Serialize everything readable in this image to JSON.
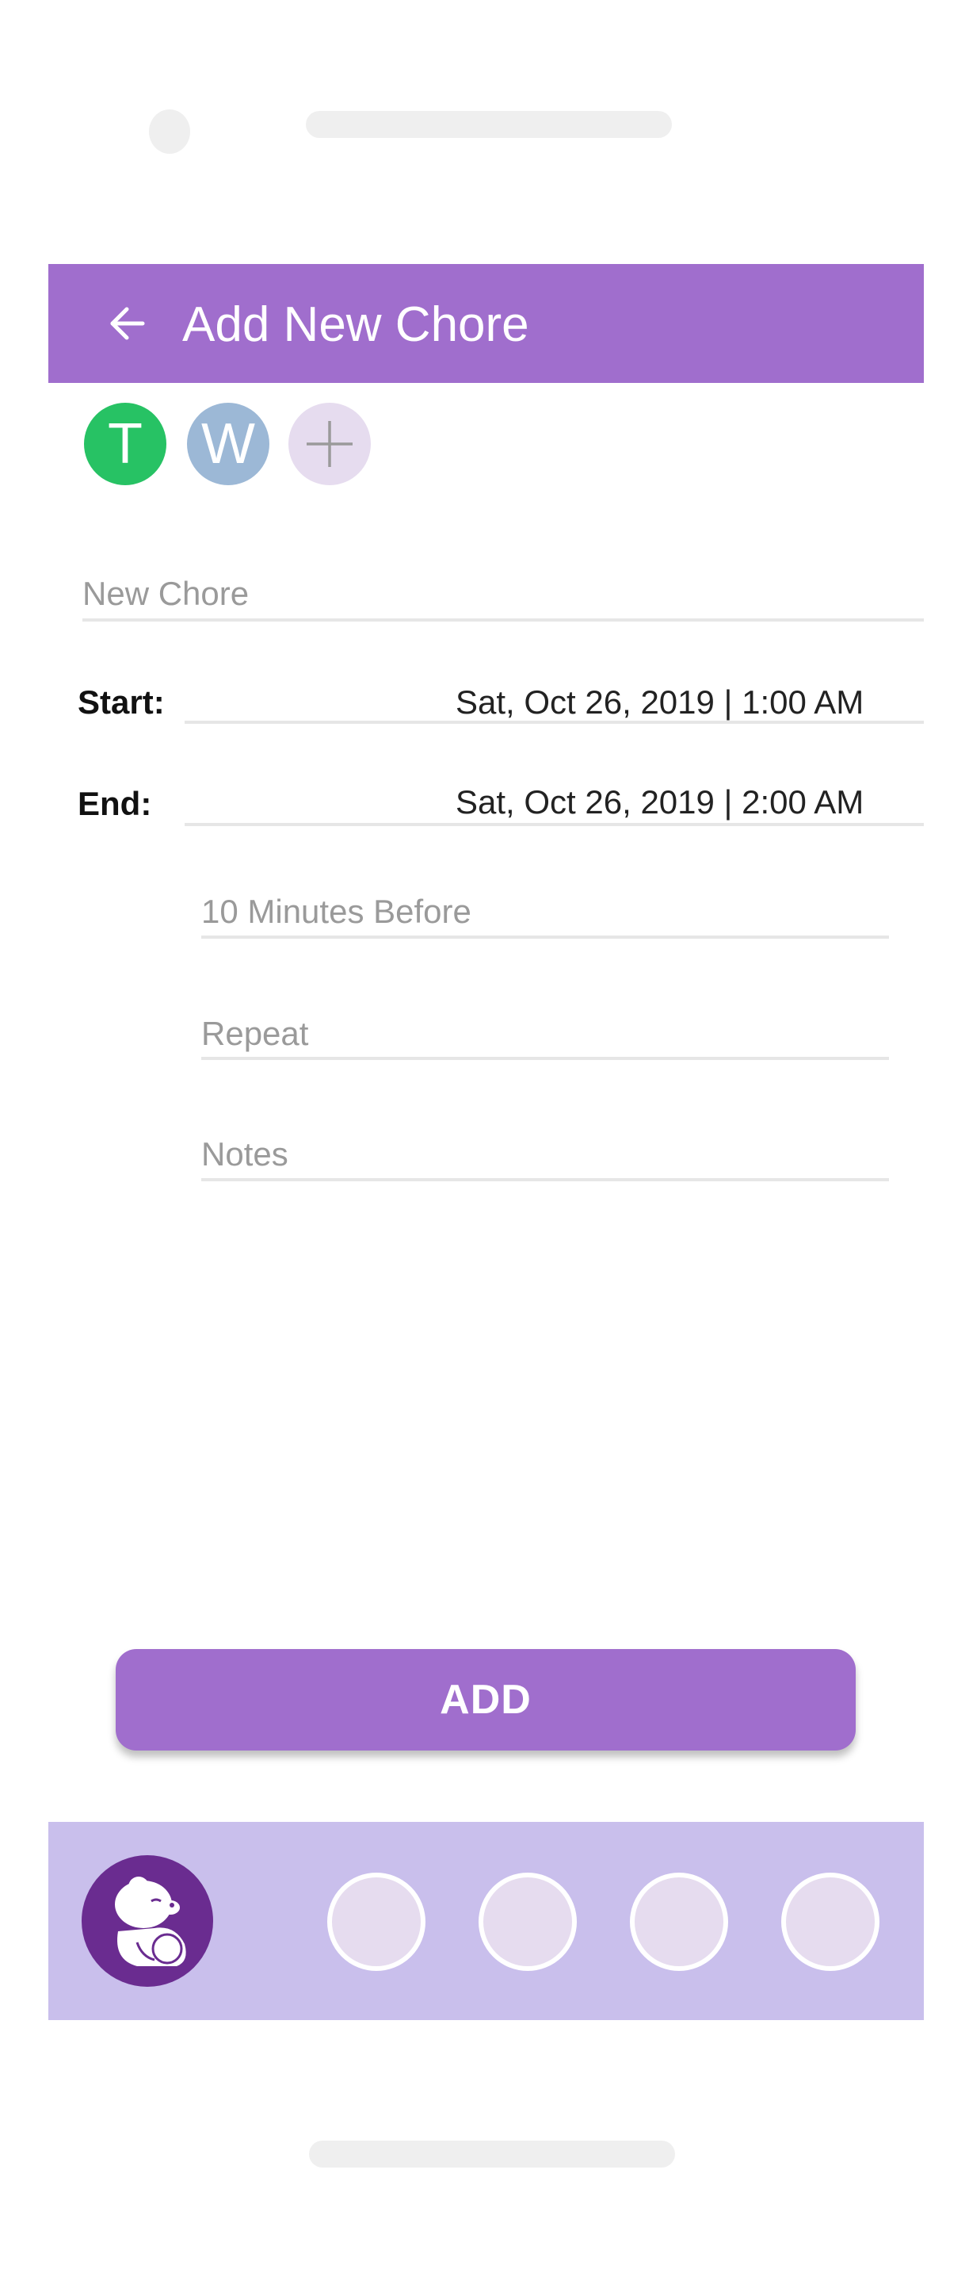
{
  "header": {
    "title": "Add New Chore",
    "back_icon": "arrow-left-icon",
    "background": "#a06ecd"
  },
  "assignees": [
    {
      "initial": "T",
      "color": "#27c264"
    },
    {
      "initial": "W",
      "color": "#9cb8d6"
    }
  ],
  "add_assignee_icon": "plus-icon",
  "form": {
    "chore_placeholder": "New Chore",
    "start_label": "Start:",
    "start_value": "Sat, Oct 26, 2019 | 1:00 AM",
    "end_label": "End:",
    "end_value": "Sat, Oct 26, 2019 | 2:00 AM",
    "reminder_placeholder": "10 Minutes Before",
    "repeat_placeholder": "Repeat",
    "notes_placeholder": "Notes"
  },
  "add_button": {
    "label": "ADD",
    "color": "#a06ecd"
  },
  "bottom_nav": {
    "background": "#c9bfec",
    "logo_icon": "teddy-bear-logo-icon",
    "items": [
      "nav-item-1",
      "nav-item-2",
      "nav-item-3",
      "nav-item-4"
    ]
  }
}
